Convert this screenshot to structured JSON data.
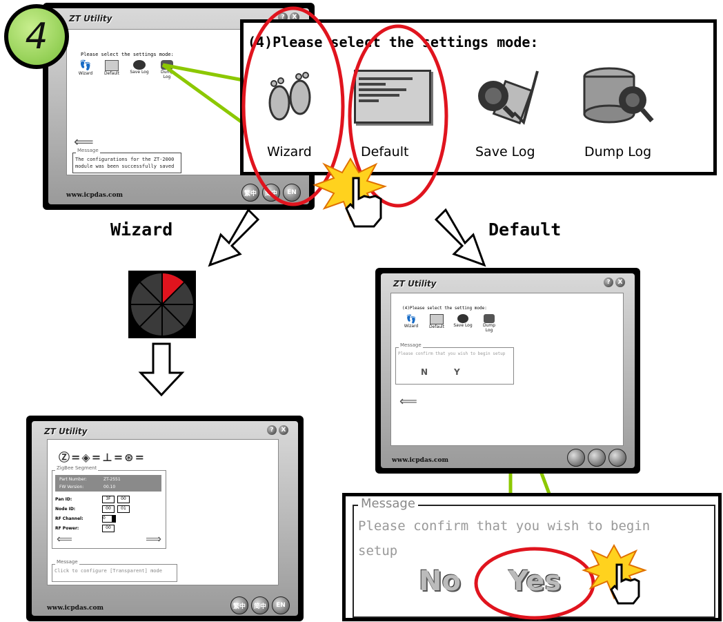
{
  "step_badge": "4",
  "top_window": {
    "title": "ZT Utility",
    "prompt": "Please select the settings mode:",
    "modes": [
      "Wizard",
      "Default",
      "Save Log",
      "Dump Log"
    ],
    "message_legend": "Message",
    "message_text": "The configurations for the ZT-2000 module was been successfully saved",
    "footer": "www.icpdas.com",
    "lang_buttons": [
      "繁中",
      "简中",
      "EN"
    ],
    "help_btn": "?",
    "close_btn": "X"
  },
  "zoom_panel": {
    "prompt": "(4)Please select the settings mode:",
    "modes": [
      "Wizard",
      "Default",
      "Save Log",
      "Dump Log"
    ]
  },
  "arrow_labels": {
    "left": "Wizard",
    "right": "Default"
  },
  "wizard_window": {
    "title": "ZT Utility",
    "group_legend": "ZigBee Segment",
    "part_number_label": "Part Number:",
    "part_number_value": "ZT-2551",
    "fw_version_label": "FW Version:",
    "fw_version_value": "00.10",
    "pan_id_label": "Pan ID:",
    "pan_id_values": [
      "3F",
      "00"
    ],
    "node_id_label": "Node ID:",
    "node_id_values": [
      "00",
      "01"
    ],
    "rf_channel_label": "RF Channel:",
    "rf_channel_value": "0",
    "rf_power_label": "RF Power:",
    "rf_power_value": "00",
    "message_legend": "Message",
    "message_text": "Click to configure [Transparent] mode",
    "footer": "www.icpdas.com",
    "lang_buttons": [
      "繁中",
      "简中",
      "EN"
    ]
  },
  "default_window": {
    "title": "ZT Utility",
    "prompt": "(4)Please select the setting mode:",
    "modes": [
      "Wizard",
      "Default",
      "Save Log",
      "Dump Log"
    ],
    "message_legend": "Message",
    "message_text": "Please confirm that you wish to begin setup",
    "footer": "www.icpdas.com"
  },
  "confirm_zoom": {
    "legend": "Message",
    "text_line1": "Please confirm that you wish to begin",
    "text_line2": "setup",
    "no_label": "No",
    "yes_label": "Yes"
  },
  "colors": {
    "highlight_red": "#e0141e",
    "connector_green": "#8cc800",
    "badge_green": "#9ad65c",
    "burst_yellow": "#ffd21e"
  }
}
